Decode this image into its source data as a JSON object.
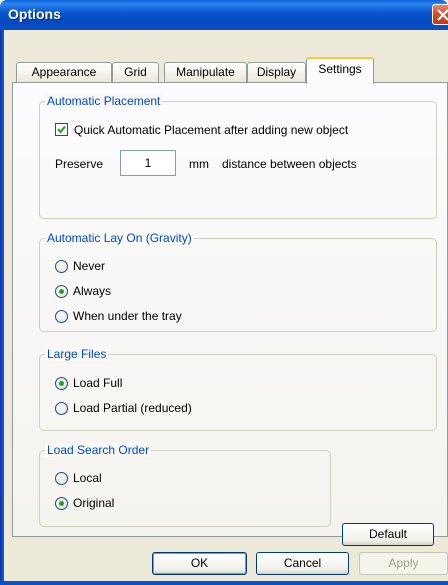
{
  "window": {
    "title": "Options"
  },
  "tabs": [
    "Appearance",
    "Grid",
    "Manipulate",
    "Display",
    "Settings"
  ],
  "active_tab": "Settings",
  "placement": {
    "title": "Automatic Placement",
    "quick_label": "Quick Automatic Placement after adding new object",
    "quick_checked": true,
    "preserve_label": "Preserve",
    "preserve_value": "1",
    "unit_label": "mm",
    "distance_label": "distance between objects"
  },
  "gravity": {
    "title": "Automatic Lay On (Gravity)",
    "options": [
      "Never",
      "Always",
      "When under the tray"
    ],
    "selected": "Always"
  },
  "large_files": {
    "title": "Large Files",
    "options": [
      "Load Full",
      "Load Partial (reduced)"
    ],
    "selected": "Load Full"
  },
  "search_order": {
    "title": "Load Search Order",
    "options": [
      "Local",
      "Original"
    ],
    "selected": "Original"
  },
  "buttons": {
    "default": "Default",
    "ok": "OK",
    "cancel": "Cancel",
    "apply": "Apply"
  }
}
